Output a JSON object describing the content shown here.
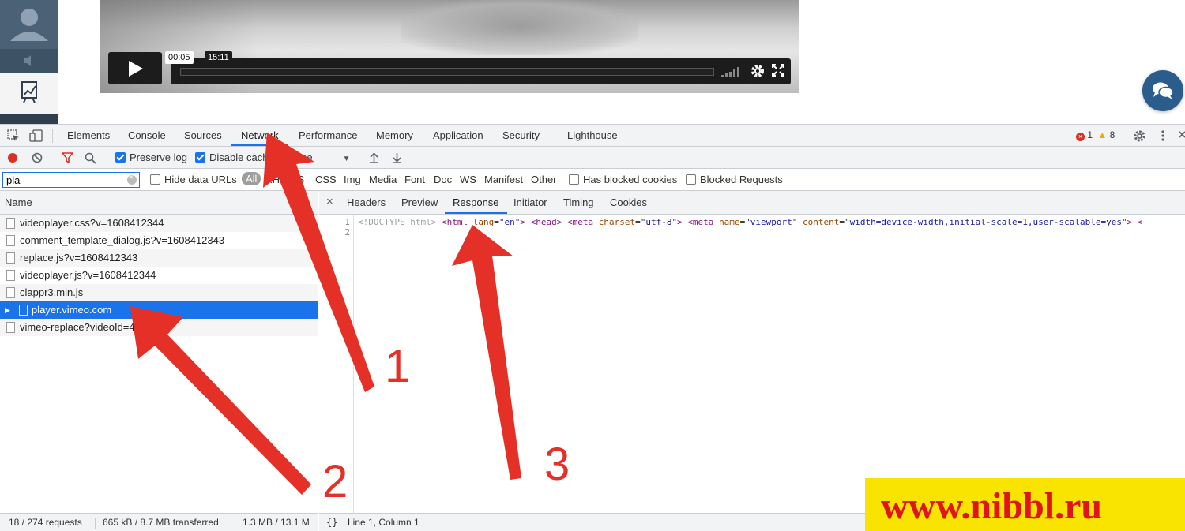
{
  "video": {
    "current_time": "00:05",
    "duration": "15:11"
  },
  "devtools": {
    "tabs": [
      "Elements",
      "Console",
      "Sources",
      "Network",
      "Performance",
      "Memory",
      "Application",
      "Security",
      "Lighthouse"
    ],
    "active_tab": "Network",
    "error_count": "1",
    "warning_count": "8",
    "toolbar": {
      "preserve_log": "Preserve log",
      "disable_cache": "Disable cache",
      "throttle": "Online"
    },
    "filter": {
      "value": "pla",
      "hide_data_urls": "Hide data URLs",
      "types": [
        "All",
        "XHR",
        "JS",
        "CSS",
        "Img",
        "Media",
        "Font",
        "Doc",
        "WS",
        "Manifest",
        "Other"
      ],
      "has_blocked_cookies": "Has blocked cookies",
      "blocked_requests": "Blocked Requests"
    },
    "request_list": {
      "header": "Name",
      "rows": [
        "videoplayer.css?v=1608412344",
        "comment_template_dialog.js?v=1608412343",
        "replace.js?v=1608412343",
        "videoplayer.js?v=1608412344",
        "clappr3.min.js",
        "player.vimeo.com",
        "vimeo-replace?videoId=4...699"
      ],
      "selected_index": 5
    },
    "status": {
      "requests": "18 / 274 requests",
      "transferred": "665 kB / 8.7 MB transferred",
      "resources": "1.3 MB / 13.1 M"
    },
    "detail": {
      "close": "×",
      "tabs": [
        "Headers",
        "Preview",
        "Response",
        "Initiator",
        "Timing",
        "Cookies"
      ],
      "active_tab": "Response",
      "line_numbers": [
        "1",
        "2"
      ],
      "code": {
        "doctype": "<!DOCTYPE html>",
        "html_open": "<html",
        "lang_attr": "lang",
        "lang_val": "\"en\"",
        "head": "<head>",
        "meta1_open": "<meta",
        "charset_attr": "charset",
        "charset_val": "\"utf-8\"",
        "meta2_open": "<meta",
        "name_attr": "name",
        "name_val": "\"viewport\"",
        "content_attr": "content",
        "content_val": "\"width=device-width,initial-scale=1,user-scalable=yes\"",
        "tail": "<"
      },
      "footer_icon": "{}",
      "cursor_position": "Line 1, Column 1"
    }
  },
  "annotations": {
    "label_1": "1",
    "label_2": "2",
    "label_3": "3"
  },
  "watermark": "www.nibbl.ru",
  "colors": {
    "accent": "#1a73e8",
    "arrow": "#e53027",
    "watermark_bg": "#f8e400",
    "watermark_text": "#e0141a"
  }
}
